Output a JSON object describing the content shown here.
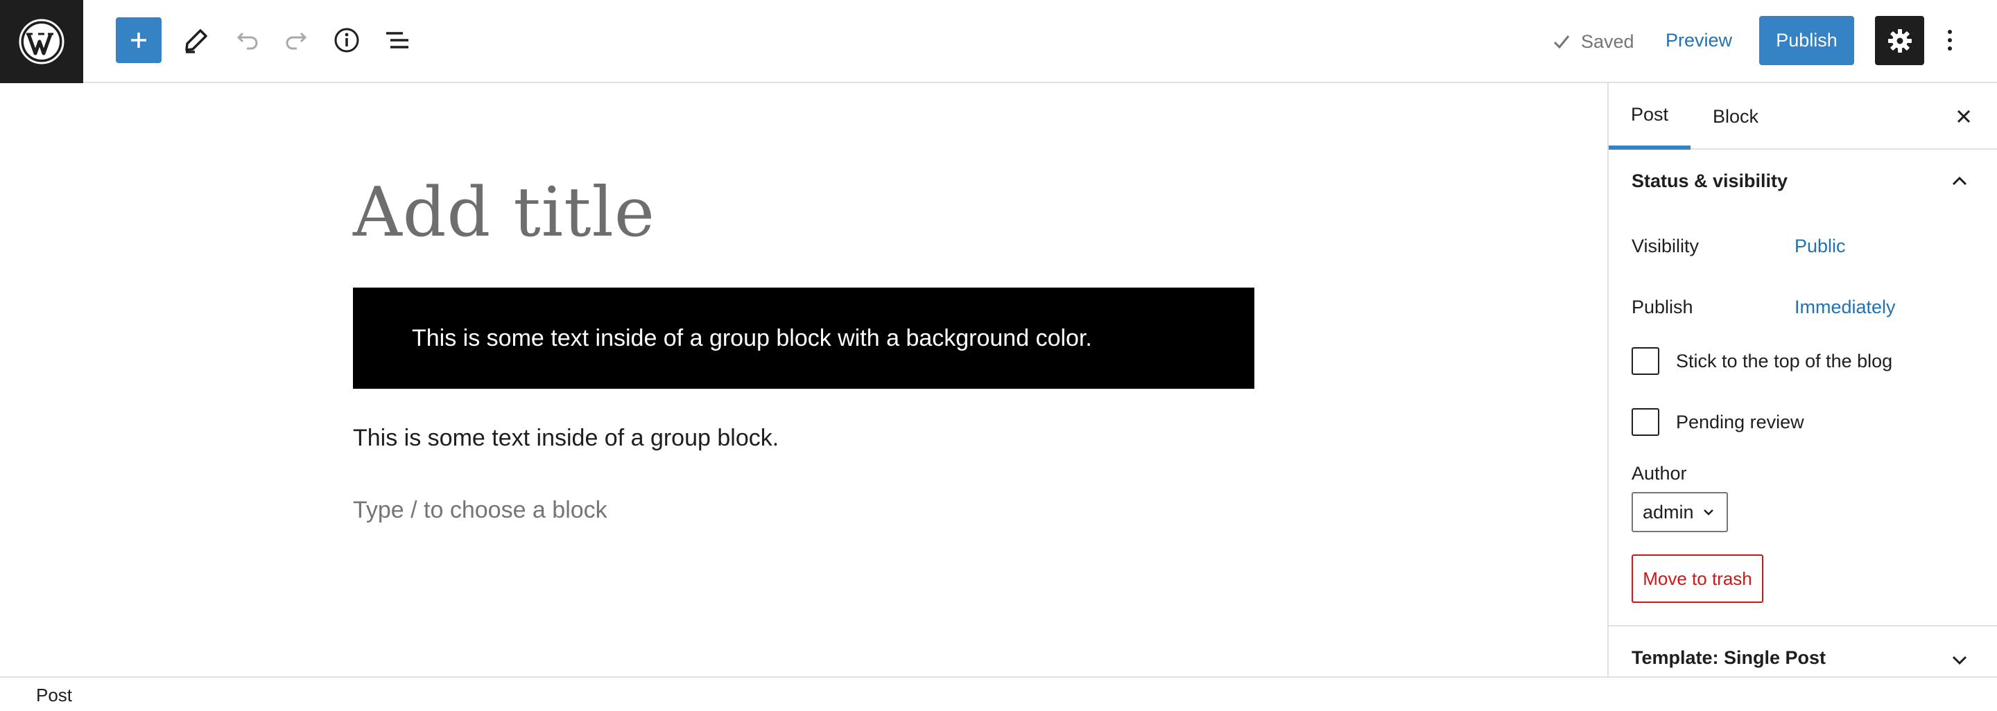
{
  "toolbar": {
    "logo_icon": "wordpress-icon",
    "inserter_icon": "plus-icon",
    "tools_icon": "pencil-icon",
    "undo_icon": "undo-icon",
    "redo_icon": "redo-icon",
    "details_icon": "info-icon",
    "outline_icon": "list-view-icon",
    "saved_label": "Saved",
    "preview_label": "Preview",
    "publish_label": "Publish",
    "settings_icon": "gear-icon",
    "more_icon": "more-vertical-icon"
  },
  "editor": {
    "title_placeholder": "Add title",
    "group_dark_text": "This is some text inside of a group block with a background color.",
    "group_text": "This is some text inside of a group block.",
    "appender_placeholder": "Type / to choose a block"
  },
  "sidebar": {
    "tabs": [
      {
        "label": "Post",
        "active": true
      },
      {
        "label": "Block",
        "active": false
      }
    ],
    "status_panel": {
      "title": "Status & visibility",
      "visibility_label": "Visibility",
      "visibility_value": "Public",
      "publish_label": "Publish",
      "publish_value": "Immediately",
      "sticky_label": "Stick to the top of the blog",
      "pending_label": "Pending review",
      "author_label": "Author",
      "author_value": "admin",
      "trash_label": "Move to trash"
    },
    "template_panel": {
      "title": "Template: Single Post"
    }
  },
  "footer": {
    "breadcrumb": "Post"
  },
  "colors": {
    "accent": "#3582c4",
    "link": "#2271b1",
    "danger": "#cc1818",
    "dark": "#1e1e1e"
  }
}
